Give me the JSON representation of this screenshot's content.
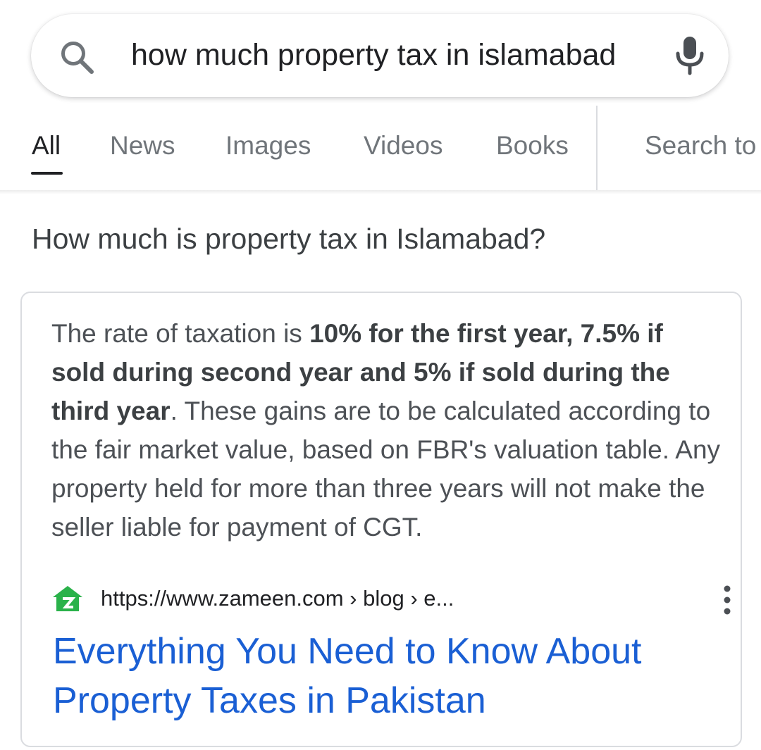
{
  "search": {
    "query": "how much property tax in islamabad",
    "search_icon": "search-icon",
    "mic_icon": "microphone-icon"
  },
  "tabs": [
    {
      "label": "All",
      "active": true
    },
    {
      "label": "News",
      "active": false
    },
    {
      "label": "Images",
      "active": false
    },
    {
      "label": "Videos",
      "active": false
    },
    {
      "label": "Books",
      "active": false
    },
    {
      "label": "Search to",
      "active": false
    }
  ],
  "featured_snippet": {
    "question": "How much is property tax in Islamabad?",
    "text_lead": "The rate of taxation is ",
    "text_bold": "10% for the first year, 7.5% if sold during second year and 5% if sold during the third year",
    "text_tail": ". These gains are to be calculated according to the fair market value, based on FBR's valuation table. Any property held for more than three years will not make the seller liable for payment of CGT.",
    "source_url": "https://www.zameen.com › blog › e...",
    "favicon": "zameen-logo-icon",
    "more_icon": "more-vert-icon",
    "result_title": "Everything You Need to Know About Property Taxes in Pakistan"
  },
  "colors": {
    "link": "#1a5fd4",
    "tab_inactive": "#70757a",
    "text": "#202124",
    "snippet_text": "#4d5156",
    "zameen_green": "#2ab24a"
  }
}
